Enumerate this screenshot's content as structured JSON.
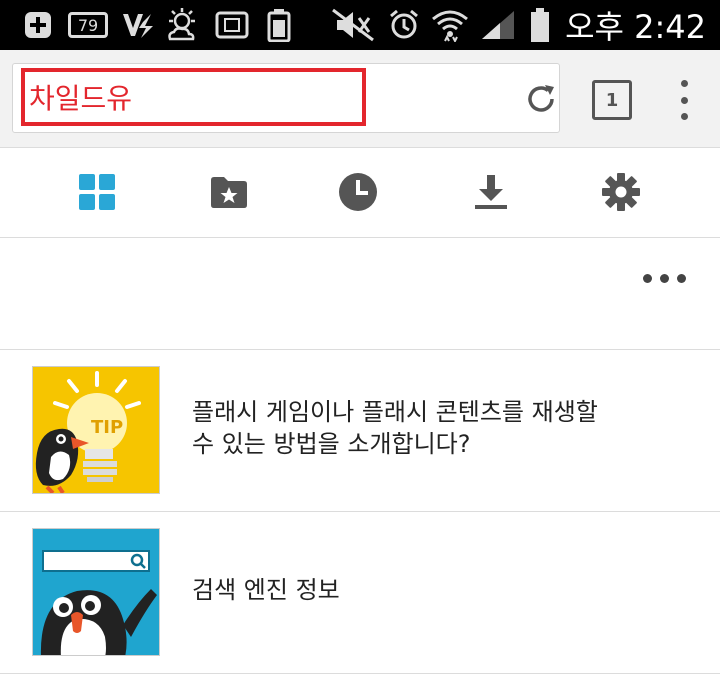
{
  "status_bar": {
    "battery_badge": "79",
    "time": "오후 2:42"
  },
  "toolbar": {
    "url_text": "차일드유",
    "tab_count": "1"
  },
  "shortcuts": [
    {
      "name": "home-grid"
    },
    {
      "name": "bookmarks"
    },
    {
      "name": "history"
    },
    {
      "name": "downloads"
    },
    {
      "name": "settings"
    }
  ],
  "articles": [
    {
      "title_line1": "플래시 게임이나 플래시 콘텐츠를 재생할",
      "title_line2": "수 있는 방법을 소개합니다?",
      "thumb_label": "TIP"
    },
    {
      "title_line1": "검색 엔진 정보"
    }
  ],
  "colors": {
    "accent_blue": "#2aa7d6",
    "highlight_red": "#e3262d",
    "tip_yellow": "#f6c500",
    "search_thumb_bg": "#1fa5cf"
  }
}
